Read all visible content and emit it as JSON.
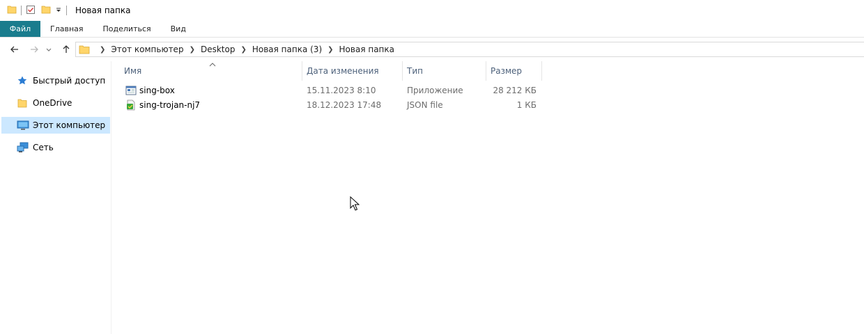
{
  "window": {
    "title": "Новая папка"
  },
  "ribbon": {
    "tabs": [
      {
        "label": "Файл",
        "active": true
      },
      {
        "label": "Главная"
      },
      {
        "label": "Поделиться"
      },
      {
        "label": "Вид"
      }
    ]
  },
  "nav": {
    "breadcrumbs": [
      {
        "label": "Этот компьютер"
      },
      {
        "label": "Desktop"
      },
      {
        "label": "Новая папка (3)"
      },
      {
        "label": "Новая папка"
      }
    ]
  },
  "sidebar": {
    "items": [
      {
        "label": "Быстрый доступ",
        "icon": "star-icon"
      },
      {
        "label": "OneDrive",
        "icon": "folder-icon"
      },
      {
        "label": "Этот компьютер",
        "icon": "computer-icon",
        "selected": true
      },
      {
        "label": "Сеть",
        "icon": "network-icon"
      }
    ]
  },
  "files": {
    "columns": {
      "name": "Имя",
      "date": "Дата изменения",
      "type": "Тип",
      "size": "Размер"
    },
    "rows": [
      {
        "name": "sing-box",
        "date": "15.11.2023 8:10",
        "type": "Приложение",
        "size": "28 212 КБ",
        "icon": "application-icon"
      },
      {
        "name": "sing-trojan-nj7",
        "date": "18.12.2023 17:48",
        "type": "JSON file",
        "size": "1 КБ",
        "icon": "json-file-icon"
      }
    ]
  },
  "colors": {
    "file_tab": "#1a7c8d",
    "selected": "#cce8ff",
    "header_text": "#4c607a"
  }
}
